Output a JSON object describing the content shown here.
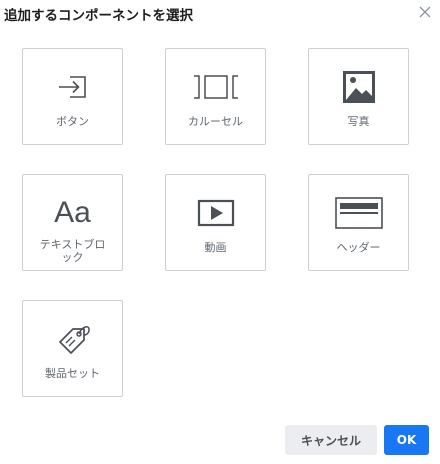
{
  "dialog": {
    "title": "追加するコンポーネントを選択",
    "close_icon": "close-icon"
  },
  "components": [
    {
      "label": "ボタン",
      "icon": "enter-box-icon"
    },
    {
      "label": "カルーセル",
      "icon": "carousel-icon"
    },
    {
      "label": "写真",
      "icon": "image-icon"
    },
    {
      "label": "テキストブロック",
      "icon": "text-aa-icon",
      "glyph": "Aa"
    },
    {
      "label": "動画",
      "icon": "play-video-icon"
    },
    {
      "label": "ヘッダー",
      "icon": "header-icon"
    },
    {
      "label": "製品セット",
      "icon": "price-tag-icon"
    }
  ],
  "footer": {
    "cancel_label": "キャンセル",
    "ok_label": "OK"
  },
  "colors": {
    "primary": "#1877f2",
    "tile_border": "#ccd0d5",
    "icon": "#4b4f56"
  }
}
